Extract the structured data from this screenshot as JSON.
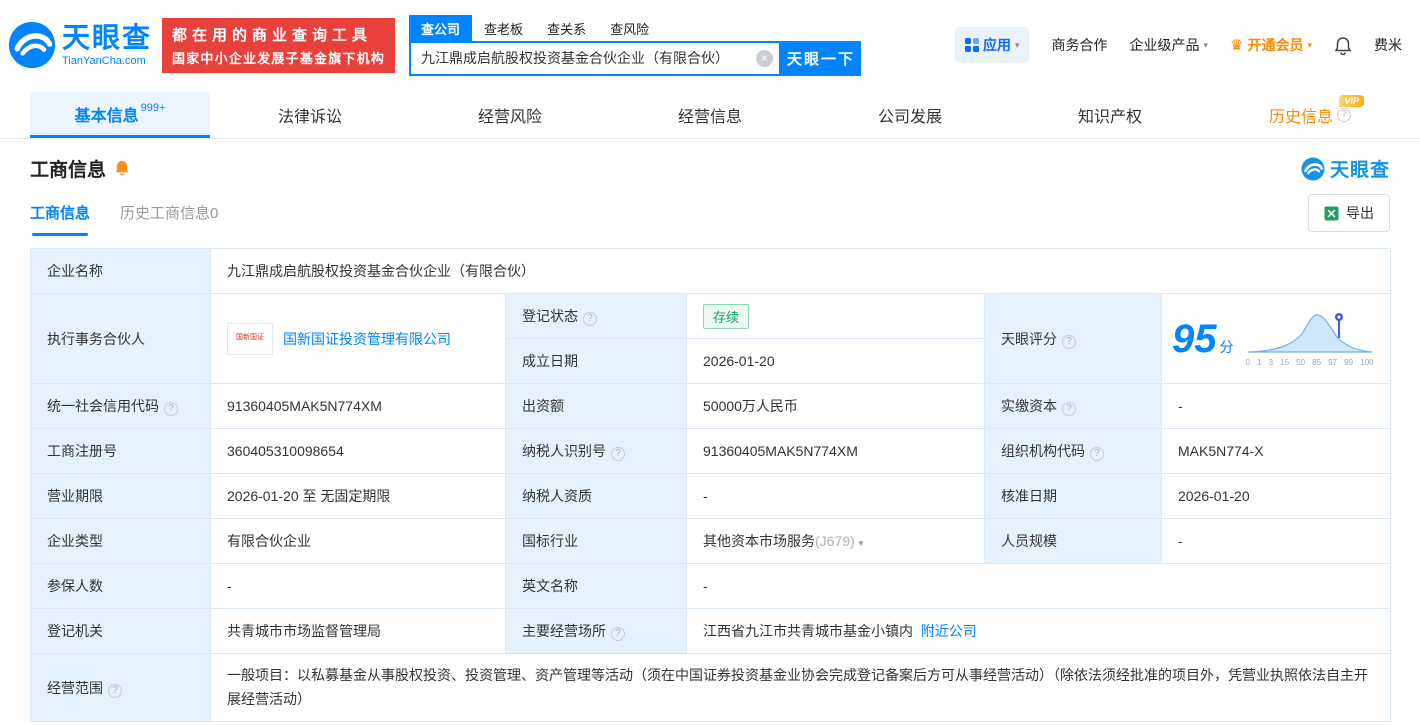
{
  "colors": {
    "brand_blue": "#0084ff",
    "vip_orange": "#ff8a00",
    "status_green": "#00a85f",
    "slogan_red": "#e8413c"
  },
  "icons": {
    "help_glyph": "?",
    "caret_down": "▾",
    "clear_glyph": "×",
    "crown_glyph": "♛",
    "vip_badge": "VIP"
  },
  "header": {
    "logo": {
      "brand": "天眼查",
      "domain": "TianYanCha.com"
    },
    "slogan_line1": "都在用的商业查询工具",
    "slogan_line2": "国家中小企业发展子基金旗下机构",
    "search": {
      "tabs": [
        {
          "label": "查公司"
        },
        {
          "label": "查老板"
        },
        {
          "label": "查关系"
        },
        {
          "label": "查风险"
        }
      ],
      "value": "九江鼎成启航股权投资基金合伙企业（有限合伙）",
      "button": "天眼一下"
    },
    "menu": {
      "apps": "应用",
      "cooperation": "商务合作",
      "enterprise": "企业级产品",
      "vip": "开通会员",
      "user": "费米"
    }
  },
  "nav": {
    "tabs": [
      {
        "label": "基本信息",
        "badge": "999+"
      },
      {
        "label": "法律诉讼"
      },
      {
        "label": "经营风险"
      },
      {
        "label": "经营信息"
      },
      {
        "label": "公司发展"
      },
      {
        "label": "知识产权"
      },
      {
        "label": "历史信息"
      }
    ]
  },
  "section": {
    "title": "工商信息",
    "brand": "天眼查",
    "subtab_active": "工商信息",
    "subtab_history": "历史工商信息0",
    "export_label": "导出"
  },
  "fields": {
    "company_name": {
      "label": "企业名称",
      "value": "九江鼎成启航股权投资基金合伙企业（有限合伙）"
    },
    "executive_partner": {
      "label": "执行事务合伙人",
      "value": "国新国证投资管理有限公司",
      "logo_text": "国新国证"
    },
    "reg_status": {
      "label": "登记状态",
      "value": "存续"
    },
    "establish_date": {
      "label": "成立日期",
      "value": "2026-01-20"
    },
    "tyc_score": {
      "label": "天眼评分",
      "value": "95",
      "unit": "分",
      "ticks": [
        "0",
        "1",
        "3",
        "15",
        "50",
        "85",
        "97",
        "99",
        "100"
      ]
    },
    "credit_code": {
      "label": "统一社会信用代码",
      "value": "91360405MAK5N774XM"
    },
    "capital": {
      "label": "出资额",
      "value": "50000万人民币"
    },
    "paid_capital": {
      "label": "实缴资本",
      "value": "-"
    },
    "reg_number": {
      "label": "工商注册号",
      "value": "360405310098654"
    },
    "taxpayer_id": {
      "label": "纳税人识别号",
      "value": "91360405MAK5N774XM"
    },
    "org_code": {
      "label": "组织机构代码",
      "value": "MAK5N774-X"
    },
    "business_term": {
      "label": "营业期限",
      "value": "2026-01-20 至 无固定期限"
    },
    "taxpayer_quality": {
      "label": "纳税人资质",
      "value": "-"
    },
    "approval_date": {
      "label": "核准日期",
      "value": "2026-01-20"
    },
    "company_type": {
      "label": "企业类型",
      "value": "有限合伙企业"
    },
    "industry": {
      "label": "国标行业",
      "value": "其他资本市场服务",
      "code": "(J679)"
    },
    "staff_size": {
      "label": "人员规模",
      "value": "-"
    },
    "insured_count": {
      "label": "参保人数",
      "value": "-"
    },
    "english_name": {
      "label": "英文名称",
      "value": "-"
    },
    "reg_authority": {
      "label": "登记机关",
      "value": "共青城市市场监督管理局"
    },
    "main_premises": {
      "label": "主要经营场所",
      "value": "江西省九江市共青城市基金小镇内",
      "link": "附近公司"
    },
    "business_scope": {
      "label": "经营范围",
      "value": "一般项目：以私募基金从事股权投资、投资管理、资产管理等活动（须在中国证券投资基金业协会完成登记备案后方可从事经营活动）（除依法须经批准的项目外，凭营业执照依法自主开展经营活动）"
    }
  }
}
